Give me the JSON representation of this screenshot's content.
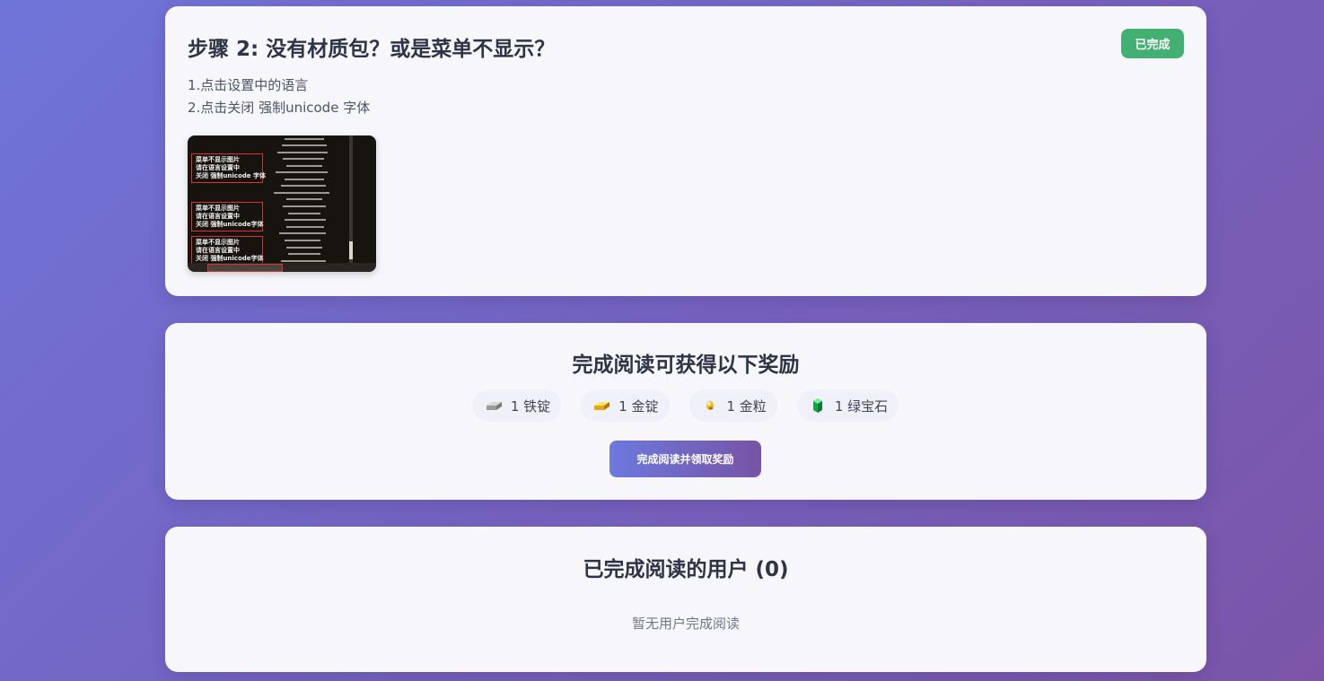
{
  "step": {
    "title": "步骤 2: 没有材质包？或是菜单不显示？",
    "status": "已完成",
    "lines": [
      "1.点击设置中的语言",
      "2.点击关闭 强制unicode 字体"
    ],
    "image_annotations": [
      [
        "菜单不显示图片",
        "请在语言设置中",
        "关闭 强制unicode 字体"
      ],
      [
        "菜单不显示图片",
        "请在语言设置中",
        "关闭 强制unicode字体"
      ],
      [
        "菜单不显示图片",
        "请在语言设置中",
        "关闭 强制unicode字体"
      ]
    ]
  },
  "rewards": {
    "title": "完成阅读可获得以下奖励",
    "items": [
      {
        "icon": "iron-ingot-icon",
        "label": "1 铁锭"
      },
      {
        "icon": "gold-ingot-icon",
        "label": "1 金锭"
      },
      {
        "icon": "gold-nugget-icon",
        "label": "1 金粒"
      },
      {
        "icon": "emerald-icon",
        "label": "1 绿宝石"
      }
    ],
    "button_label": "完成阅读并领取奖励"
  },
  "users": {
    "title": "已完成阅读的用户 (0)",
    "empty_text": "暂无用户完成阅读"
  },
  "colors": {
    "badge": "#43b073",
    "button_start": "#6c79dd",
    "button_end": "#7753a6"
  }
}
